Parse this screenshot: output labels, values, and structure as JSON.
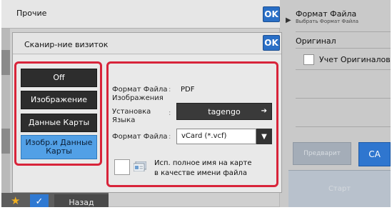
{
  "background": {
    "title": "Прочие",
    "ok_label": "OK"
  },
  "right_panel": {
    "format_title": "Формат Файла",
    "format_sub": "Выбрать Формат Файла",
    "original_title": "Оригинал",
    "count_label": "Учет Оригиналов",
    "preview_label": "Предварит",
    "ca_label": "CA",
    "start_label": "Старт"
  },
  "bottom": {
    "back_label": "Назад"
  },
  "dialog": {
    "title": "Сканир-ние визиток",
    "ok_label": "OK",
    "modes": [
      {
        "label": "Off",
        "selected": false
      },
      {
        "label": "Изображение",
        "selected": false
      },
      {
        "label": "Данные Карты",
        "selected": false
      },
      {
        "label": "Изобр.и Данные Карты",
        "selected": true
      }
    ],
    "image_format_label": "Формат Файла Изображения",
    "image_format_value": "PDF",
    "language_label": "Установка Языка",
    "language_value": "tagengo",
    "file_format_label": "Формат Файла",
    "file_format_value": "vCard (*.vcf)",
    "fullname_label": "Исп. полное имя на карте в качестве имени файла"
  },
  "colors": {
    "accent_blue": "#2a6fc6",
    "selected_mode": "#52a0e6",
    "highlight_red": "#d8243a"
  }
}
